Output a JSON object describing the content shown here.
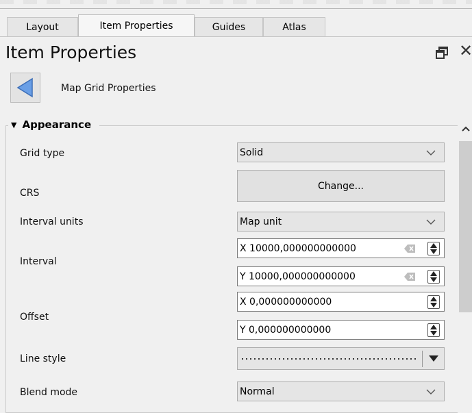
{
  "tabs": [
    "Layout",
    "Item Properties",
    "Guides",
    "Atlas"
  ],
  "active_tab": "Item Properties",
  "panel": {
    "title": "Item Properties",
    "back_label": "Map Grid Properties"
  },
  "group": {
    "title": "Appearance",
    "rows": {
      "grid_type": {
        "label": "Grid type",
        "value": "Solid"
      },
      "crs": {
        "label": "CRS",
        "button": "Change..."
      },
      "interval_units": {
        "label": "Interval units",
        "value": "Map unit"
      },
      "interval": {
        "label": "Interval",
        "x": "X 10000,000000000000",
        "y": "Y 10000,000000000000"
      },
      "offset": {
        "label": "Offset",
        "x": "X 0,000000000000",
        "y": "Y 0,000000000000"
      },
      "line_style": {
        "label": "Line style"
      },
      "blend_mode": {
        "label": "Blend mode",
        "value": "Normal"
      }
    }
  },
  "icons": {
    "back": "back-arrow-icon",
    "float": "float-icon",
    "close": "close-icon",
    "clear": "clear-icon"
  },
  "colors": {
    "back_arrow": "#5b8fd8",
    "panel_bg": "#f0f0f0"
  }
}
